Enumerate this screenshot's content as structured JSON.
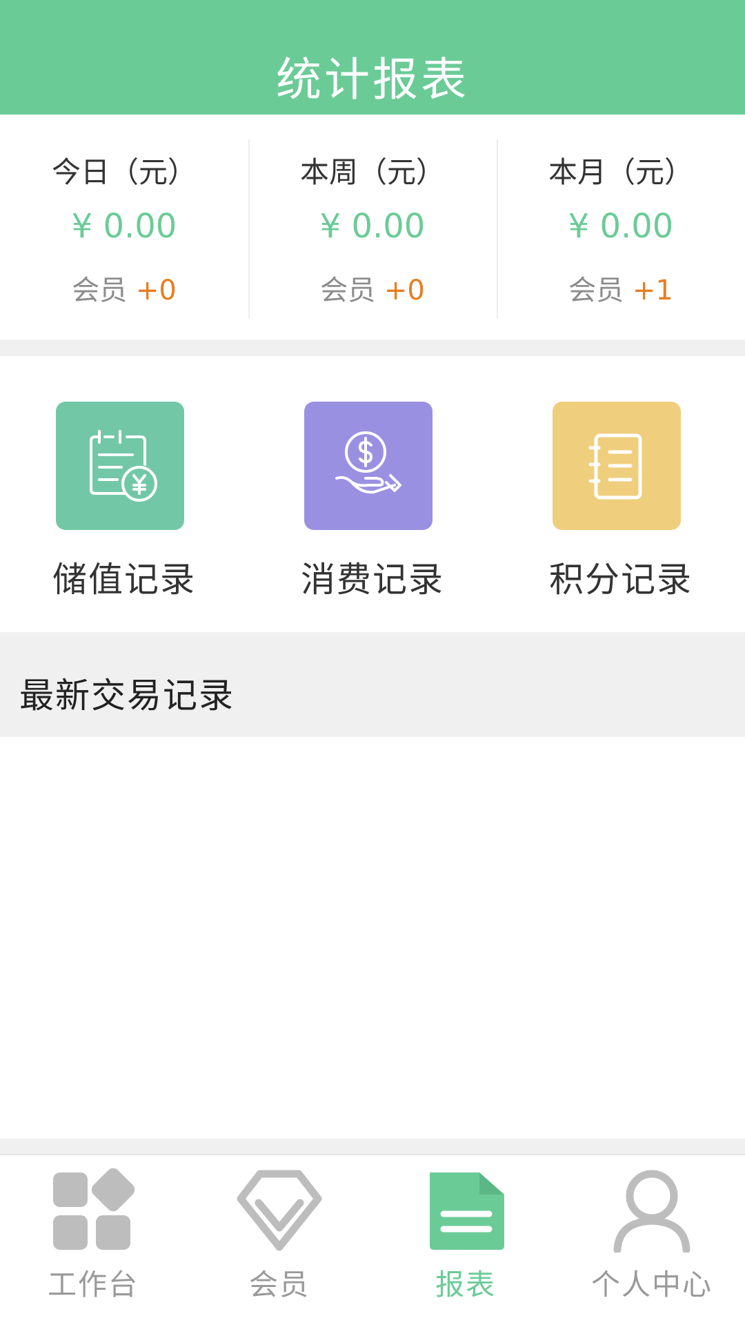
{
  "header": {
    "title": "统计报表"
  },
  "colors": {
    "accent": "#6BCB97",
    "delta": "#E67E22",
    "tile_green": "#72C8A6",
    "tile_purple": "#9A90E2",
    "tile_yellow": "#EFCE7D"
  },
  "stats": [
    {
      "label": "今日（元）",
      "amount": "¥ 0.00",
      "members_prefix": "会员 ",
      "members_delta": "+0"
    },
    {
      "label": "本周（元）",
      "amount": "¥ 0.00",
      "members_prefix": "会员 ",
      "members_delta": "+0"
    },
    {
      "label": "本月（元）",
      "amount": "¥ 0.00",
      "members_prefix": "会员 ",
      "members_delta": "+1"
    }
  ],
  "shortcuts": [
    {
      "label": "储值记录",
      "icon": "calendar-yuan-icon"
    },
    {
      "label": "消费记录",
      "icon": "hand-dollar-icon"
    },
    {
      "label": "积分记录",
      "icon": "notebook-icon"
    }
  ],
  "section": {
    "title": "最新交易记录"
  },
  "tabbar": [
    {
      "label": "工作台",
      "icon": "grid-icon",
      "active": false
    },
    {
      "label": "会员",
      "icon": "diamond-icon",
      "active": false
    },
    {
      "label": "报表",
      "icon": "report-icon",
      "active": true
    },
    {
      "label": "个人中心",
      "icon": "person-icon",
      "active": false
    }
  ]
}
